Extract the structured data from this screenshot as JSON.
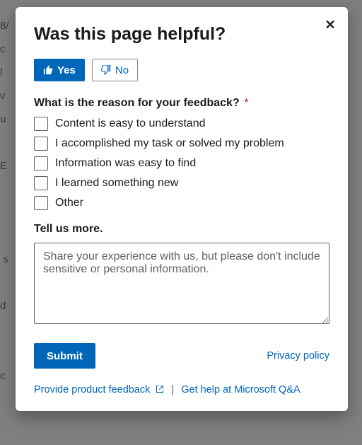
{
  "modal": {
    "title": "Was this page helpful?",
    "close_aria": "Close",
    "yes_label": "Yes",
    "no_label": "No",
    "reason_question": "What is the reason for your feedback?",
    "required_marker": "*",
    "options": [
      "Content is easy to understand",
      "I accomplished my task or solved my problem",
      "Information was easy to find",
      "I learned something new",
      "Other"
    ],
    "tell_us_label": "Tell us more.",
    "textarea_placeholder": "Share your experience with us, but please don't include sensitive or personal information.",
    "submit_label": "Submit",
    "privacy_label": "Privacy policy",
    "product_feedback_label": "Provide product feedback",
    "qa_label": "Get help at Microsoft Q&A"
  },
  "colors": {
    "primary": "#0067b8",
    "text": "#1b1a19",
    "border": "#605e5c",
    "required": "#a4262c"
  }
}
